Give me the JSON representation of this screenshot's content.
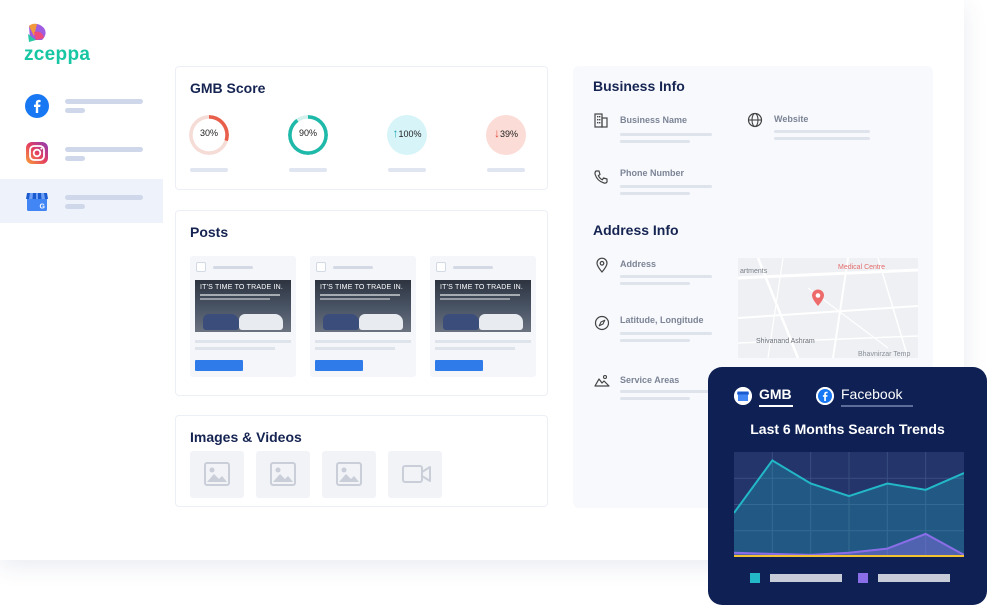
{
  "brand": {
    "name": "zceppa",
    "color": "#17c6a3"
  },
  "sidebar": {
    "items": [
      {
        "icon": "facebook-icon",
        "active": false
      },
      {
        "icon": "instagram-icon",
        "active": false
      },
      {
        "icon": "google-my-business-icon",
        "active": true
      }
    ]
  },
  "gmb_score": {
    "title": "GMB Score",
    "gauges": [
      {
        "label": "30%",
        "percent": 30,
        "color": "#e8604c",
        "track": "#f6dcd6",
        "bg": "#ffffff",
        "arrow": ""
      },
      {
        "label": "90%",
        "percent": 90,
        "color": "#1fb9a9",
        "track": "#d5f1ee",
        "bg": "#ffffff",
        "arrow": ""
      },
      {
        "label": "100%",
        "percent": 100,
        "color": "#d7f5f9",
        "track": "#d7f5f9",
        "bg": "#d7f5f9",
        "arrow": "↑",
        "arrow_color": "#1fa8b0"
      },
      {
        "label": "39%",
        "percent": 39,
        "color": "#fbdcd6",
        "track": "#fbdcd6",
        "bg": "#fbdcd6",
        "arrow": "↓",
        "arrow_color": "#e24b3a"
      }
    ]
  },
  "posts": {
    "title": "Posts",
    "items": [
      {
        "headline": "IT'S TIME TO TRADE IN."
      },
      {
        "headline": "IT'S TIME TO TRADE IN."
      },
      {
        "headline": "IT'S TIME TO TRADE IN."
      }
    ]
  },
  "media": {
    "title": "Images & Videos",
    "items": [
      "image-icon",
      "image-icon",
      "image-icon",
      "video-icon"
    ]
  },
  "business_info": {
    "title": "Business Info",
    "business_name": "Business Name",
    "website": "Website",
    "phone_number": "Phone Number"
  },
  "address_info": {
    "title": "Address Info",
    "address": "Address",
    "lat_long": "Latitude, Longitude",
    "service_areas": "Service Areas",
    "map": {
      "label_left": "artments",
      "label_medical": "Medical Centre",
      "label_ashram": "Shivanand Ashram",
      "label_temple": "Bhavnirzar Temp"
    }
  },
  "trends": {
    "tabs": [
      {
        "label": "GMB",
        "active": true,
        "icon": "gmb-icon"
      },
      {
        "label": "Facebook",
        "active": false,
        "icon": "facebook-icon"
      }
    ],
    "title": "Last 6 Months Search Trends",
    "chart_data": {
      "type": "area",
      "series": [
        {
          "values": [
            42,
            92,
            70,
            58,
            70,
            64,
            80
          ],
          "color": "#22b8c8"
        },
        {
          "values": [
            4,
            3,
            2,
            4,
            8,
            22,
            2
          ],
          "color": "#8a6ee8"
        },
        {
          "values": [
            1,
            1,
            1,
            1,
            1,
            1,
            1
          ],
          "color": "#f2c230"
        }
      ],
      "ylim": [
        0,
        100
      ],
      "grid": true
    },
    "legend_colors": [
      "#22b8c8",
      "#8a6ee8"
    ]
  }
}
